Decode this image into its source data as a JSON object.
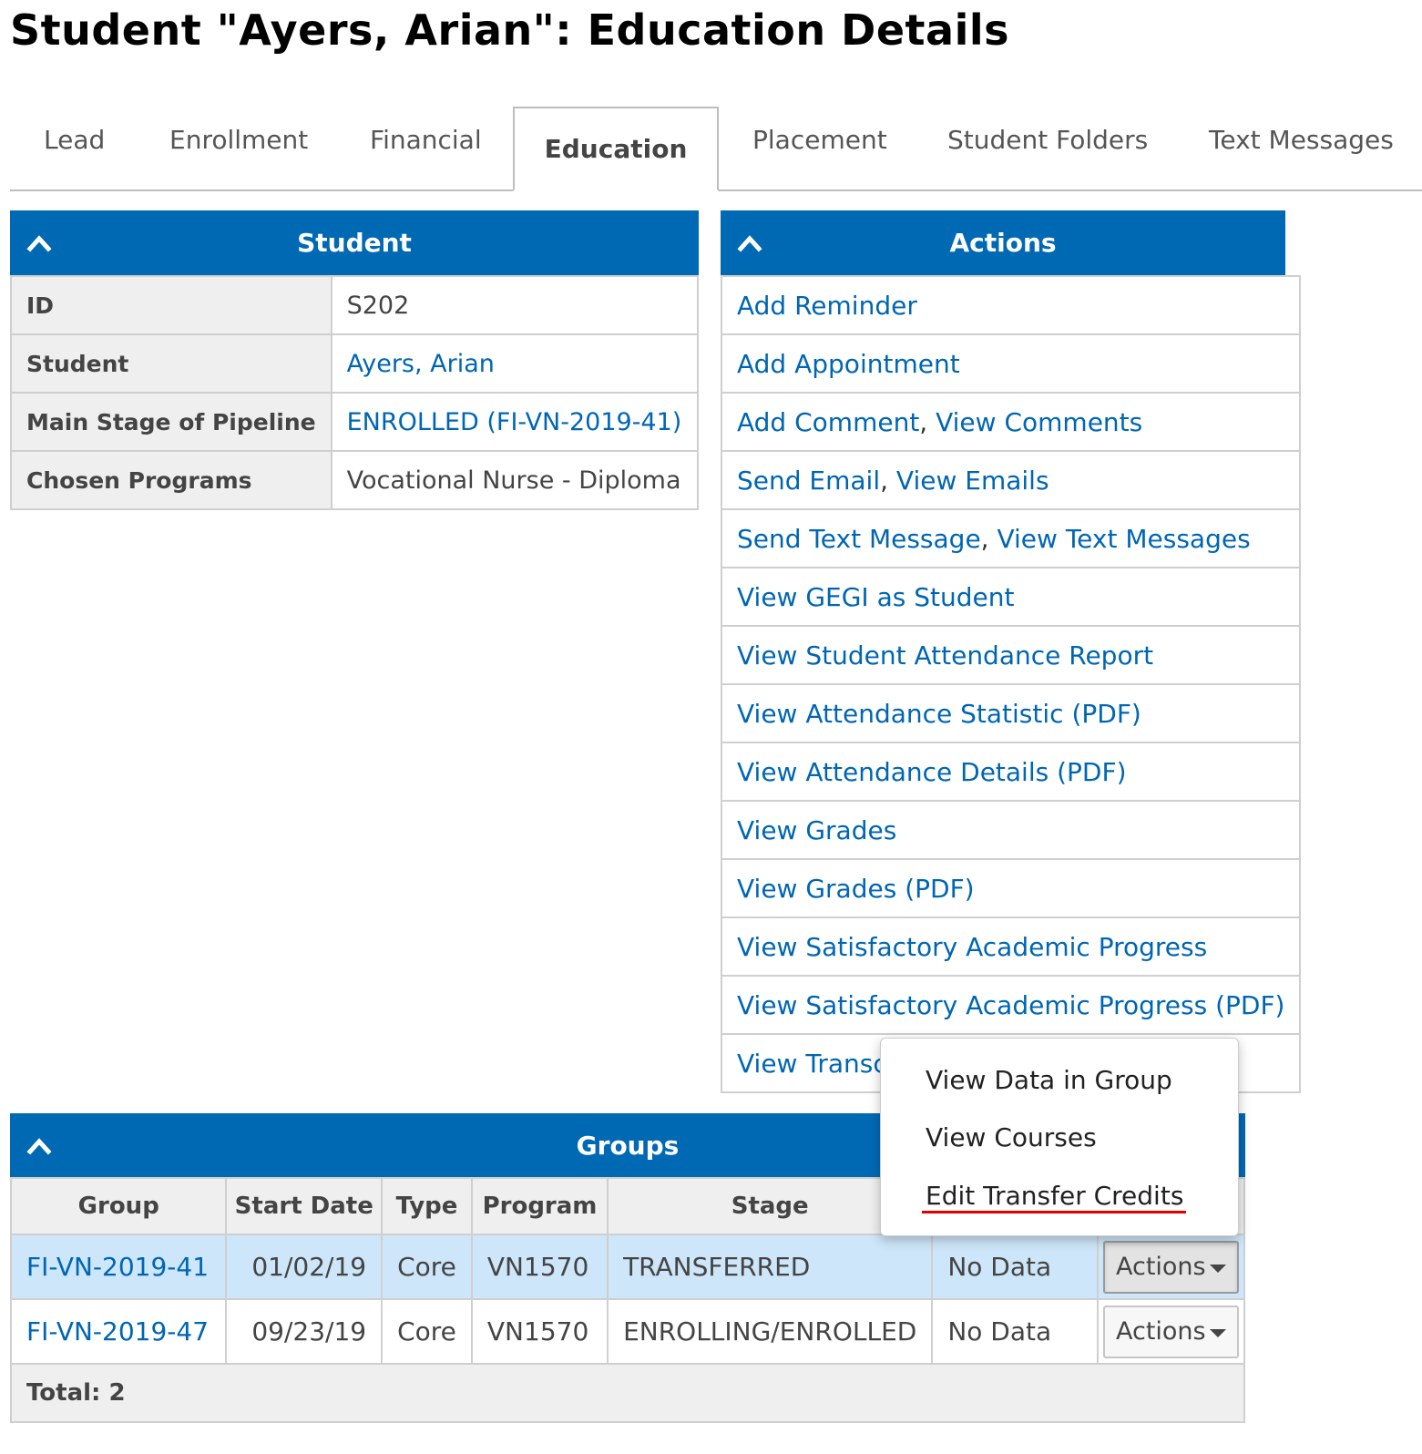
{
  "page": {
    "title": "Student \"Ayers, Arian\": Education Details"
  },
  "tabs": [
    {
      "label": "Lead"
    },
    {
      "label": "Enrollment"
    },
    {
      "label": "Financial"
    },
    {
      "label": "Education",
      "active": true
    },
    {
      "label": "Placement"
    },
    {
      "label": "Student Folders"
    },
    {
      "label": "Text Messages"
    }
  ],
  "student_panel": {
    "title": "Student",
    "rows": [
      {
        "label": "ID",
        "value": "S202"
      },
      {
        "label": "Student",
        "value": "Ayers, Arian"
      },
      {
        "label": "Main Stage of Pipeline",
        "value": "ENROLLED (FI-VN-2019-41)"
      },
      {
        "label": "Chosen Programs",
        "value": "Vocational Nurse - Diploma"
      }
    ]
  },
  "actions_panel": {
    "title": "Actions",
    "items": [
      {
        "a": "Add Reminder"
      },
      {
        "a": "Add Appointment"
      },
      {
        "a": "Add Comment",
        "sep": ", ",
        "b": "View Comments"
      },
      {
        "a": "Send Email",
        "sep": ", ",
        "b": "View Emails"
      },
      {
        "a": "Send Text Message",
        "sep": ", ",
        "b": "View Text Messages"
      },
      {
        "a": "View GEGI as Student"
      },
      {
        "a": "View Student Attendance Report"
      },
      {
        "a": "View Attendance Statistic (PDF)"
      },
      {
        "a": "View Attendance Details (PDF)"
      },
      {
        "a": "View Grades"
      },
      {
        "a": "View Grades (PDF)"
      },
      {
        "a": "View Satisfactory Academic Progress"
      },
      {
        "a": "View Satisfactory Academic Progress (PDF)"
      },
      {
        "a": "View Transc"
      }
    ]
  },
  "groups_panel": {
    "title": "Groups",
    "columns": [
      "Group",
      "Start Date",
      "Type",
      "Program",
      "Stage",
      "",
      ""
    ],
    "rows": [
      {
        "group": "FI-VN-2019-41",
        "start_date": "01/02/19",
        "type": "Core",
        "program": "VN1570",
        "stage": "TRANSFERRED",
        "data": "No Data",
        "action": "Actions"
      },
      {
        "group": "FI-VN-2019-47",
        "start_date": "09/23/19",
        "type": "Core",
        "program": "VN1570",
        "stage": "ENROLLING/ENROLLED",
        "data": "No Data",
        "action": "Actions"
      }
    ],
    "total": "Total: 2"
  },
  "dropdown_menu": {
    "items": [
      "View Data in Group",
      "View Courses",
      "Edit Transfer Credits"
    ],
    "highlight_color": "#e00000"
  },
  "colors": {
    "header_blue": "#0069b4",
    "link": "#0066b3",
    "selected_row": "#cde6f9"
  }
}
